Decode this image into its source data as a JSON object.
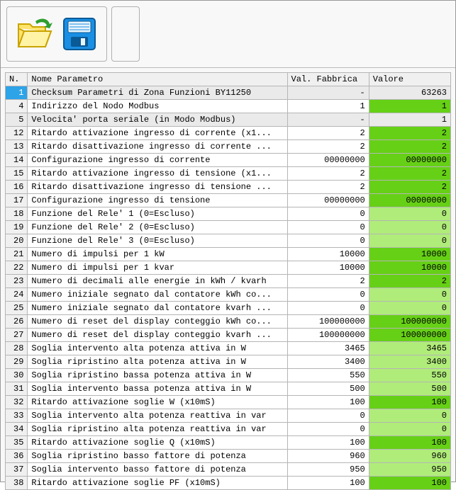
{
  "toolbar": {
    "open_label": "Open",
    "save_label": "Save"
  },
  "grid": {
    "headers": {
      "n": "N.",
      "name": "Nome Parametro",
      "fab": "Val. Fabbrica",
      "val": "Valore"
    },
    "rows": [
      {
        "n": "1",
        "name": "Checksum Parametri di Zona Funzioni BY11250",
        "fab": "-",
        "val": "63263",
        "val_class": "",
        "row": "selected"
      },
      {
        "n": "4",
        "name": "Indirizzo del Nodo Modbus",
        "fab": "1",
        "val": "1",
        "val_class": "val-green",
        "row": ""
      },
      {
        "n": "5",
        "name": "Velocita' porta seriale (in Modo Modbus)",
        "fab": "-",
        "val": "1",
        "val_class": "val-green",
        "row": "gray"
      },
      {
        "n": "12",
        "name": "Ritardo attivazione ingresso di corrente (x1...",
        "fab": "2",
        "val": "2",
        "val_class": "val-green",
        "row": ""
      },
      {
        "n": "13",
        "name": "Ritardo disattivazione ingresso di corrente ...",
        "fab": "2",
        "val": "2",
        "val_class": "val-green",
        "row": ""
      },
      {
        "n": "14",
        "name": "Configurazione ingresso di corrente",
        "fab": "00000000",
        "val": "00000000",
        "val_class": "val-green",
        "row": ""
      },
      {
        "n": "15",
        "name": "Ritardo attivazione ingresso di tensione (x1...",
        "fab": "2",
        "val": "2",
        "val_class": "val-green",
        "row": ""
      },
      {
        "n": "16",
        "name": "Ritardo disattivazione ingresso di tensione ...",
        "fab": "2",
        "val": "2",
        "val_class": "val-green",
        "row": ""
      },
      {
        "n": "17",
        "name": "Configurazione ingresso di tensione",
        "fab": "00000000",
        "val": "00000000",
        "val_class": "val-green",
        "row": ""
      },
      {
        "n": "18",
        "name": "Funzione del Rele' 1 (0=Escluso)",
        "fab": "0",
        "val": "0",
        "val_class": "val-lightgreen",
        "row": ""
      },
      {
        "n": "19",
        "name": "Funzione del Rele' 2 (0=Escluso)",
        "fab": "0",
        "val": "0",
        "val_class": "val-lightgreen",
        "row": ""
      },
      {
        "n": "20",
        "name": "Funzione del Rele' 3 (0=Escluso)",
        "fab": "0",
        "val": "0",
        "val_class": "val-lightgreen",
        "row": ""
      },
      {
        "n": "21",
        "name": "Numero di impulsi per 1 kW",
        "fab": "10000",
        "val": "10000",
        "val_class": "val-green",
        "row": ""
      },
      {
        "n": "22",
        "name": "Numero di impulsi per 1 kvar",
        "fab": "10000",
        "val": "10000",
        "val_class": "val-green",
        "row": ""
      },
      {
        "n": "23",
        "name": "Numero di decimali alle energie in kWh / kvarh",
        "fab": "2",
        "val": "2",
        "val_class": "val-green",
        "row": ""
      },
      {
        "n": "24",
        "name": "Numero iniziale segnato dal contatore kWh co...",
        "fab": "0",
        "val": "0",
        "val_class": "val-lightgreen",
        "row": ""
      },
      {
        "n": "25",
        "name": "Numero iniziale segnato dal contatore kvarh ...",
        "fab": "0",
        "val": "0",
        "val_class": "val-lightgreen",
        "row": ""
      },
      {
        "n": "26",
        "name": "Numero di reset del display conteggio kWh co...",
        "fab": "100000000",
        "val": "100000000",
        "val_class": "val-green",
        "row": ""
      },
      {
        "n": "27",
        "name": "Numero di reset del display conteggio kvarh ...",
        "fab": "100000000",
        "val": "100000000",
        "val_class": "val-green",
        "row": ""
      },
      {
        "n": "28",
        "name": "Soglia intervento alta potenza attiva in W",
        "fab": "3465",
        "val": "3465",
        "val_class": "val-lightgreen",
        "row": ""
      },
      {
        "n": "29",
        "name": "Soglia ripristino alta potenza attiva in W",
        "fab": "3400",
        "val": "3400",
        "val_class": "val-lightgreen",
        "row": ""
      },
      {
        "n": "30",
        "name": "Soglia ripristino bassa potenza attiva in W",
        "fab": "550",
        "val": "550",
        "val_class": "val-lightgreen",
        "row": ""
      },
      {
        "n": "31",
        "name": "Soglia intervento bassa potenza attiva in W",
        "fab": "500",
        "val": "500",
        "val_class": "val-lightgreen",
        "row": ""
      },
      {
        "n": "32",
        "name": "Ritardo attivazione soglie W (x10mS)",
        "fab": "100",
        "val": "100",
        "val_class": "val-green",
        "row": ""
      },
      {
        "n": "33",
        "name": "Soglia intervento alta potenza reattiva in var",
        "fab": "0",
        "val": "0",
        "val_class": "val-lightgreen",
        "row": ""
      },
      {
        "n": "34",
        "name": "Soglia ripristino alta potenza reattiva in var",
        "fab": "0",
        "val": "0",
        "val_class": "val-lightgreen",
        "row": ""
      },
      {
        "n": "35",
        "name": "Ritardo attivazione soglie Q (x10mS)",
        "fab": "100",
        "val": "100",
        "val_class": "val-green",
        "row": ""
      },
      {
        "n": "36",
        "name": "Soglia ripristino basso fattore di potenza",
        "fab": "960",
        "val": "960",
        "val_class": "val-lightgreen",
        "row": ""
      },
      {
        "n": "37",
        "name": "Soglia intervento basso fattore di potenza",
        "fab": "950",
        "val": "950",
        "val_class": "val-lightgreen",
        "row": ""
      },
      {
        "n": "38",
        "name": "Ritardo attivazione soglie PF (x10mS)",
        "fab": "100",
        "val": "100",
        "val_class": "val-green",
        "row": ""
      }
    ]
  }
}
